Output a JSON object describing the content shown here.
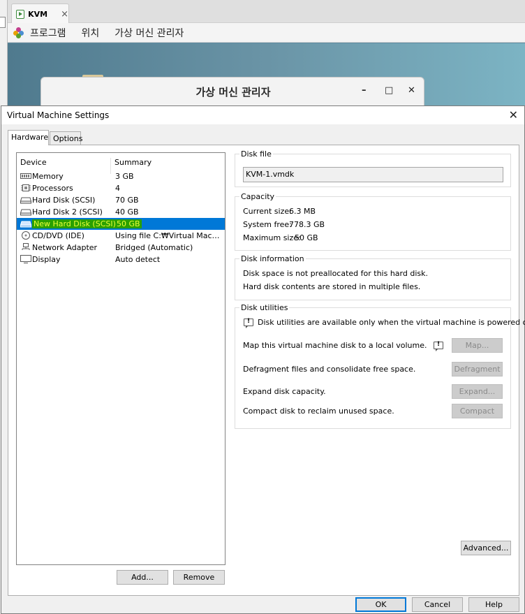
{
  "bg": {
    "tab_title": "KVM",
    "tab_close": "×",
    "menu": [
      "프로그램",
      "위치",
      "가상 머신 관리자"
    ],
    "vmm_title": "가상 머신 관리자",
    "vmm_min": "–",
    "vmm_max": "□",
    "vmm_close": "✕"
  },
  "dialog": {
    "title": "Virtual Machine Settings",
    "close": "✕",
    "tabs": [
      "Hardware",
      "Options"
    ]
  },
  "device_list": {
    "col_device": "Device",
    "col_summary": "Summary",
    "rows": [
      {
        "name": "Memory",
        "summary": "3 GB",
        "icon": "memory-icon"
      },
      {
        "name": "Processors",
        "summary": "4",
        "icon": "processor-icon"
      },
      {
        "name": "Hard Disk (SCSI)",
        "summary": "70 GB",
        "icon": "hard-disk-icon"
      },
      {
        "name": "Hard Disk 2 (SCSI)",
        "summary": "40 GB",
        "icon": "hard-disk-icon"
      },
      {
        "name": "New Hard Disk (SCSI)",
        "summary": "50 GB",
        "icon": "hard-disk-icon",
        "selected": true
      },
      {
        "name": "CD/DVD (IDE)",
        "summary": "Using file C:₩Virtual Machin…",
        "icon": "cd-dvd-icon"
      },
      {
        "name": "Network Adapter",
        "summary": "Bridged (Automatic)",
        "icon": "network-icon"
      },
      {
        "name": "Display",
        "summary": "Auto detect",
        "icon": "display-icon"
      }
    ],
    "add_label": "Add...",
    "remove_label": "Remove"
  },
  "disk_file": {
    "legend": "Disk file",
    "value": "KVM-1.vmdk"
  },
  "capacity": {
    "legend": "Capacity",
    "current_label": "Current size:",
    "current_value": "6.3 MB",
    "free_label": "System free:",
    "free_value": "778.3 GB",
    "max_label": "Maximum size:",
    "max_value": "50 GB"
  },
  "disk_info": {
    "legend": "Disk information",
    "line1": "Disk space is not preallocated for this hard disk.",
    "line2": "Hard disk contents are stored in multiple files."
  },
  "disk_utils": {
    "legend": "Disk utilities",
    "notice": "Disk utilities are available only when the virtual machine is powered off.",
    "map_text": "Map this virtual machine disk to a local volume.",
    "map_btn": "Map...",
    "defrag_text": "Defragment files and consolidate free space.",
    "defrag_btn": "Defragment",
    "expand_text": "Expand disk capacity.",
    "expand_btn": "Expand...",
    "compact_text": "Compact disk to reclaim unused space.",
    "compact_btn": "Compact"
  },
  "advanced_btn": "Advanced...",
  "footer": {
    "ok": "OK",
    "cancel": "Cancel",
    "help": "Help"
  }
}
